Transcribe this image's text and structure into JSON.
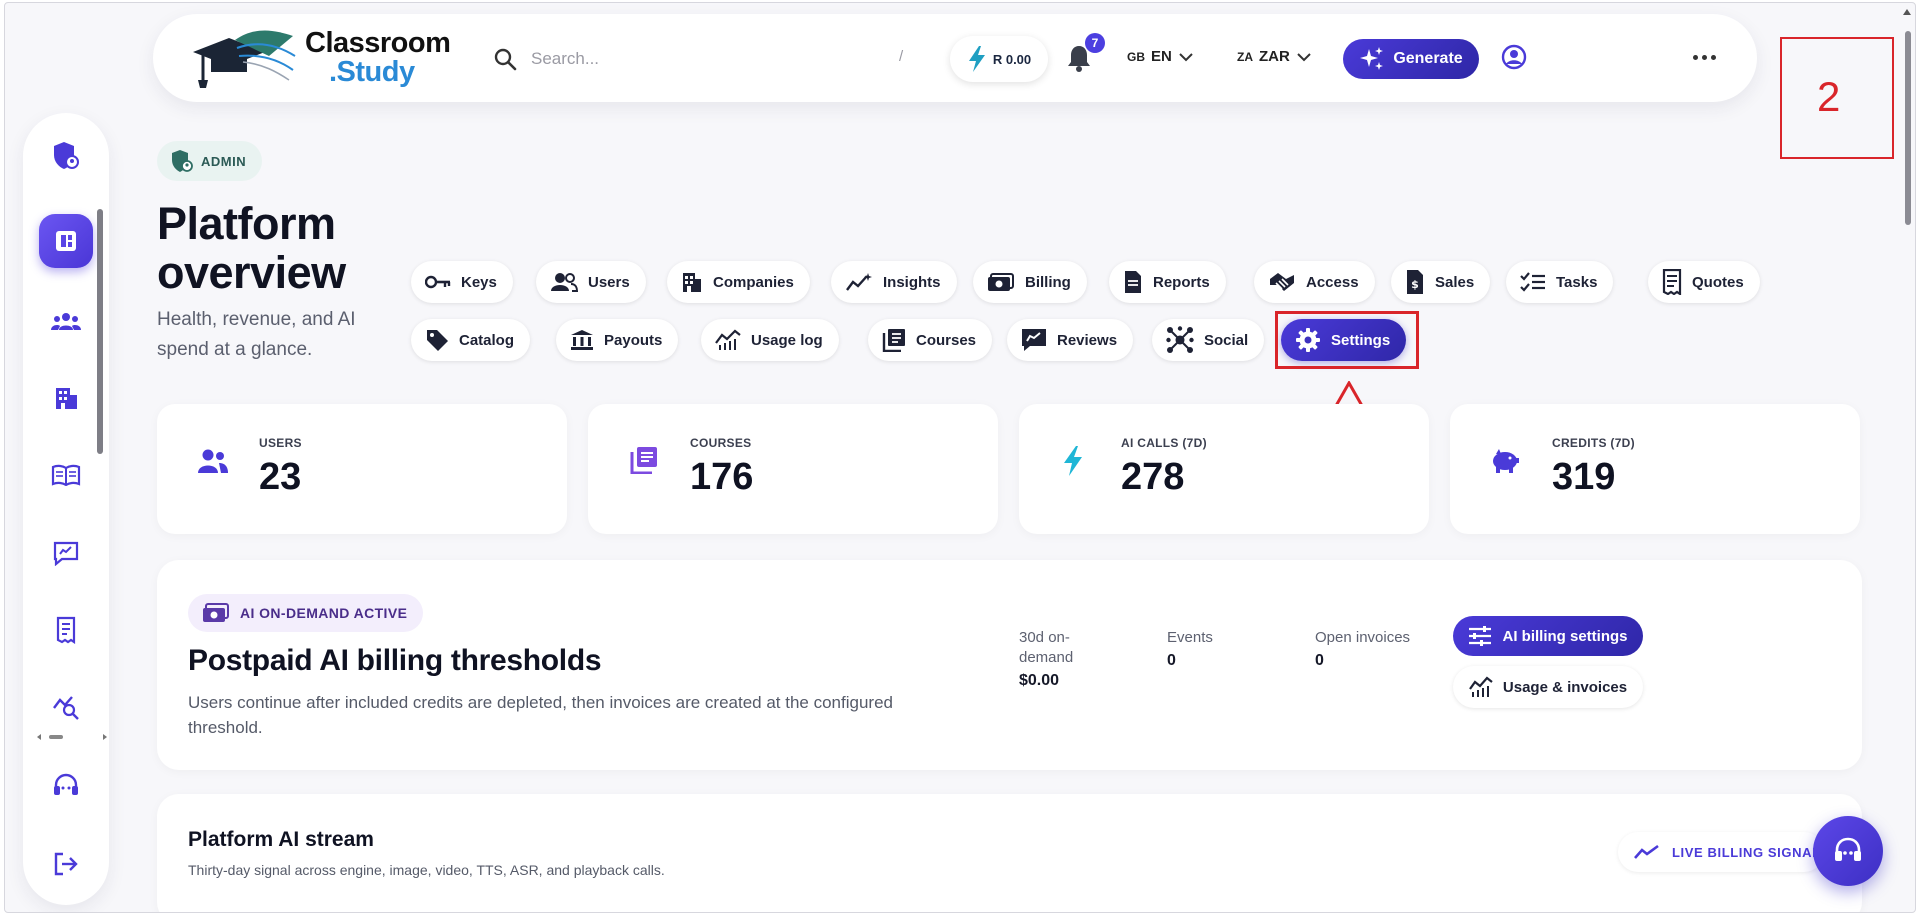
{
  "brand": {
    "line1": "Classroom",
    "line2": ".Study"
  },
  "search": {
    "placeholder": "Search...",
    "shortcut": "/"
  },
  "credit": {
    "label": "R 0.00"
  },
  "notifications": {
    "count": "7"
  },
  "language": {
    "country": "GB",
    "code": "EN"
  },
  "currency": {
    "country": "ZA",
    "code": "ZAR"
  },
  "generate": {
    "label": "Generate"
  },
  "annotation": {
    "step_number": "2"
  },
  "header": {
    "badge": "ADMIN",
    "title": "Platform overview",
    "subtitle": "Health, revenue, and AI spend at a glance."
  },
  "tabs": [
    {
      "label": "Keys",
      "icon": "key-icon"
    },
    {
      "label": "Users",
      "icon": "users-icon"
    },
    {
      "label": "Companies",
      "icon": "building-icon"
    },
    {
      "label": "Insights",
      "icon": "sparkline-icon"
    },
    {
      "label": "Billing",
      "icon": "money-icon"
    },
    {
      "label": "Reports",
      "icon": "document-icon"
    },
    {
      "label": "Access",
      "icon": "handshake-icon"
    },
    {
      "label": "Sales",
      "icon": "invoice-icon"
    },
    {
      "label": "Tasks",
      "icon": "checklist-icon"
    },
    {
      "label": "Quotes",
      "icon": "receipt-icon"
    },
    {
      "label": "Catalog",
      "icon": "tag-icon"
    },
    {
      "label": "Payouts",
      "icon": "bank-icon"
    },
    {
      "label": "Usage log",
      "icon": "chart-icon"
    },
    {
      "label": "Courses",
      "icon": "library-icon"
    },
    {
      "label": "Reviews",
      "icon": "review-icon"
    },
    {
      "label": "Social",
      "icon": "network-icon"
    },
    {
      "label": "Settings",
      "icon": "gear-icon",
      "active": true
    }
  ],
  "stats": [
    {
      "label": "USERS",
      "value": "23",
      "icon": "users-icon",
      "color": "#4a3ad8"
    },
    {
      "label": "COURSES",
      "value": "176",
      "icon": "library-icon",
      "color": "#7c4ae0"
    },
    {
      "label": "AI CALLS (7D)",
      "value": "278",
      "icon": "bolt-icon",
      "color": "#1fb6d6"
    },
    {
      "label": "CREDITS (7D)",
      "value": "319",
      "icon": "piggy-bank-icon",
      "color": "#4a3ad8"
    }
  ],
  "billing": {
    "badge": "AI ON-DEMAND ACTIVE",
    "title": "Postpaid AI billing thresholds",
    "description": "Users continue after included credits are depleted, then invoices are created at the configured threshold.",
    "metrics": [
      {
        "key": "30d on-demand",
        "value": "$0.00"
      },
      {
        "key": "Events",
        "value": "0"
      },
      {
        "key": "Open invoices",
        "value": "0"
      }
    ],
    "settings_button": "AI billing settings",
    "usage_button": "Usage & invoices"
  },
  "stream": {
    "title": "Platform AI stream",
    "description": "Thirty-day signal across engine, image, video, TTS, ASR, and playback calls.",
    "badge": "LIVE BILLING SIGNAL"
  },
  "colors": {
    "accent": "#4a3ad8",
    "annotation": "#d9252a",
    "brand_blue": "#2a8ad6"
  }
}
